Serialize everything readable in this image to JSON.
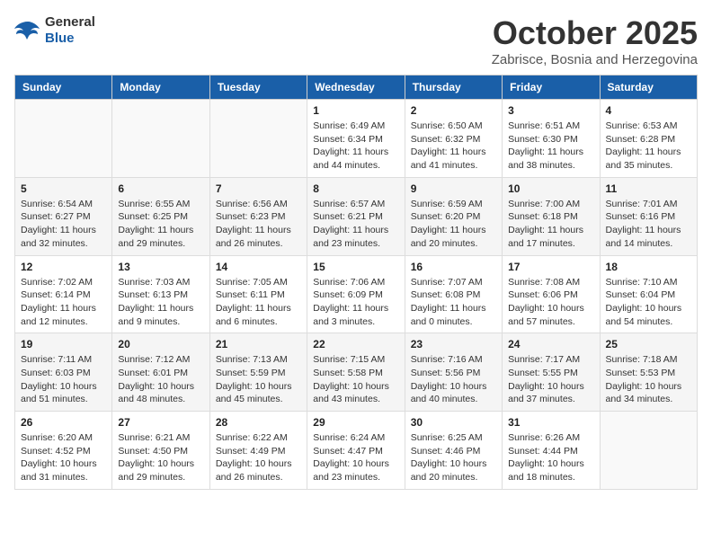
{
  "header": {
    "logo_general": "General",
    "logo_blue": "Blue",
    "month_title": "October 2025",
    "location": "Zabrisce, Bosnia and Herzegovina"
  },
  "days_of_week": [
    "Sunday",
    "Monday",
    "Tuesday",
    "Wednesday",
    "Thursday",
    "Friday",
    "Saturday"
  ],
  "weeks": [
    [
      {
        "day": "",
        "info": ""
      },
      {
        "day": "",
        "info": ""
      },
      {
        "day": "",
        "info": ""
      },
      {
        "day": "1",
        "info": "Sunrise: 6:49 AM\nSunset: 6:34 PM\nDaylight: 11 hours and 44 minutes."
      },
      {
        "day": "2",
        "info": "Sunrise: 6:50 AM\nSunset: 6:32 PM\nDaylight: 11 hours and 41 minutes."
      },
      {
        "day": "3",
        "info": "Sunrise: 6:51 AM\nSunset: 6:30 PM\nDaylight: 11 hours and 38 minutes."
      },
      {
        "day": "4",
        "info": "Sunrise: 6:53 AM\nSunset: 6:28 PM\nDaylight: 11 hours and 35 minutes."
      }
    ],
    [
      {
        "day": "5",
        "info": "Sunrise: 6:54 AM\nSunset: 6:27 PM\nDaylight: 11 hours and 32 minutes."
      },
      {
        "day": "6",
        "info": "Sunrise: 6:55 AM\nSunset: 6:25 PM\nDaylight: 11 hours and 29 minutes."
      },
      {
        "day": "7",
        "info": "Sunrise: 6:56 AM\nSunset: 6:23 PM\nDaylight: 11 hours and 26 minutes."
      },
      {
        "day": "8",
        "info": "Sunrise: 6:57 AM\nSunset: 6:21 PM\nDaylight: 11 hours and 23 minutes."
      },
      {
        "day": "9",
        "info": "Sunrise: 6:59 AM\nSunset: 6:20 PM\nDaylight: 11 hours and 20 minutes."
      },
      {
        "day": "10",
        "info": "Sunrise: 7:00 AM\nSunset: 6:18 PM\nDaylight: 11 hours and 17 minutes."
      },
      {
        "day": "11",
        "info": "Sunrise: 7:01 AM\nSunset: 6:16 PM\nDaylight: 11 hours and 14 minutes."
      }
    ],
    [
      {
        "day": "12",
        "info": "Sunrise: 7:02 AM\nSunset: 6:14 PM\nDaylight: 11 hours and 12 minutes."
      },
      {
        "day": "13",
        "info": "Sunrise: 7:03 AM\nSunset: 6:13 PM\nDaylight: 11 hours and 9 minutes."
      },
      {
        "day": "14",
        "info": "Sunrise: 7:05 AM\nSunset: 6:11 PM\nDaylight: 11 hours and 6 minutes."
      },
      {
        "day": "15",
        "info": "Sunrise: 7:06 AM\nSunset: 6:09 PM\nDaylight: 11 hours and 3 minutes."
      },
      {
        "day": "16",
        "info": "Sunrise: 7:07 AM\nSunset: 6:08 PM\nDaylight: 11 hours and 0 minutes."
      },
      {
        "day": "17",
        "info": "Sunrise: 7:08 AM\nSunset: 6:06 PM\nDaylight: 10 hours and 57 minutes."
      },
      {
        "day": "18",
        "info": "Sunrise: 7:10 AM\nSunset: 6:04 PM\nDaylight: 10 hours and 54 minutes."
      }
    ],
    [
      {
        "day": "19",
        "info": "Sunrise: 7:11 AM\nSunset: 6:03 PM\nDaylight: 10 hours and 51 minutes."
      },
      {
        "day": "20",
        "info": "Sunrise: 7:12 AM\nSunset: 6:01 PM\nDaylight: 10 hours and 48 minutes."
      },
      {
        "day": "21",
        "info": "Sunrise: 7:13 AM\nSunset: 5:59 PM\nDaylight: 10 hours and 45 minutes."
      },
      {
        "day": "22",
        "info": "Sunrise: 7:15 AM\nSunset: 5:58 PM\nDaylight: 10 hours and 43 minutes."
      },
      {
        "day": "23",
        "info": "Sunrise: 7:16 AM\nSunset: 5:56 PM\nDaylight: 10 hours and 40 minutes."
      },
      {
        "day": "24",
        "info": "Sunrise: 7:17 AM\nSunset: 5:55 PM\nDaylight: 10 hours and 37 minutes."
      },
      {
        "day": "25",
        "info": "Sunrise: 7:18 AM\nSunset: 5:53 PM\nDaylight: 10 hours and 34 minutes."
      }
    ],
    [
      {
        "day": "26",
        "info": "Sunrise: 6:20 AM\nSunset: 4:52 PM\nDaylight: 10 hours and 31 minutes."
      },
      {
        "day": "27",
        "info": "Sunrise: 6:21 AM\nSunset: 4:50 PM\nDaylight: 10 hours and 29 minutes."
      },
      {
        "day": "28",
        "info": "Sunrise: 6:22 AM\nSunset: 4:49 PM\nDaylight: 10 hours and 26 minutes."
      },
      {
        "day": "29",
        "info": "Sunrise: 6:24 AM\nSunset: 4:47 PM\nDaylight: 10 hours and 23 minutes."
      },
      {
        "day": "30",
        "info": "Sunrise: 6:25 AM\nSunset: 4:46 PM\nDaylight: 10 hours and 20 minutes."
      },
      {
        "day": "31",
        "info": "Sunrise: 6:26 AM\nSunset: 4:44 PM\nDaylight: 10 hours and 18 minutes."
      },
      {
        "day": "",
        "info": ""
      }
    ]
  ]
}
